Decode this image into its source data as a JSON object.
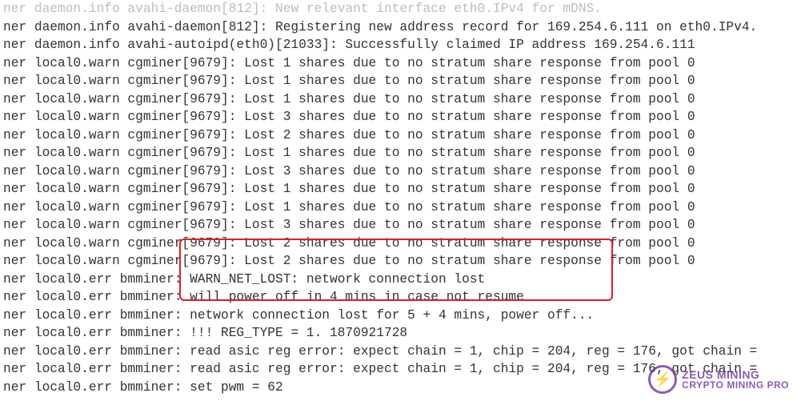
{
  "log_lines": [
    {
      "text": "ner daemon.info avahi-daemon[812]: New relevant interface eth0.IPv4 for mDNS.",
      "faded": true
    },
    {
      "text": "ner daemon.info avahi-daemon[812]: Registering new address record for 169.254.6.111 on eth0.IPv4."
    },
    {
      "text": "ner daemon.info avahi-autoipd(eth0)[21033]: Successfully claimed IP address 169.254.6.111"
    },
    {
      "text": "ner local0.warn cgminer[9679]: Lost 1 shares due to no stratum share response from pool 0"
    },
    {
      "text": "ner local0.warn cgminer[9679]: Lost 1 shares due to no stratum share response from pool 0"
    },
    {
      "text": "ner local0.warn cgminer[9679]: Lost 1 shares due to no stratum share response from pool 0"
    },
    {
      "text": "ner local0.warn cgminer[9679]: Lost 3 shares due to no stratum share response from pool 0"
    },
    {
      "text": "ner local0.warn cgminer[9679]: Lost 2 shares due to no stratum share response from pool 0"
    },
    {
      "text": "ner local0.warn cgminer[9679]: Lost 1 shares due to no stratum share response from pool 0"
    },
    {
      "text": "ner local0.warn cgminer[9679]: Lost 3 shares due to no stratum share response from pool 0"
    },
    {
      "text": "ner local0.warn cgminer[9679]: Lost 1 shares due to no stratum share response from pool 0"
    },
    {
      "text": "ner local0.warn cgminer[9679]: Lost 1 shares due to no stratum share response from pool 0"
    },
    {
      "text": "ner local0.warn cgminer[9679]: Lost 3 shares due to no stratum share response from pool 0"
    },
    {
      "text": "ner local0.warn cgminer[9679]: Lost 2 shares due to no stratum share response from pool 0"
    },
    {
      "text": "ner local0.warn cgminer[9679]: Lost 2 shares due to no stratum share response from pool 0"
    },
    {
      "text": "ner local0.err bmminer: WARN_NET_LOST: network connection lost"
    },
    {
      "text": "ner local0.err bmminer: will power off in 4 mins in case not resume"
    },
    {
      "text": "ner local0.err bmminer: network connection lost for 5 + 4 mins, power off..."
    },
    {
      "text": "ner local0.err bmminer: !!! REG_TYPE = 1. 1870921728"
    },
    {
      "text": "ner local0.err bmminer: read asic reg error: expect chain = 1, chip = 204, reg = 176, got chain ="
    },
    {
      "text": "ner local0.err bmminer: read asic reg error: expect chain = 1, chip = 204, reg = 176, got chain ="
    },
    {
      "text": "ner local0.err bmminer: set pwm = 62"
    }
  ],
  "watermark": {
    "line1": "ZEUS MINING",
    "line2": "CRYPTO MINING PRO",
    "icon_glyph": "⚡"
  }
}
